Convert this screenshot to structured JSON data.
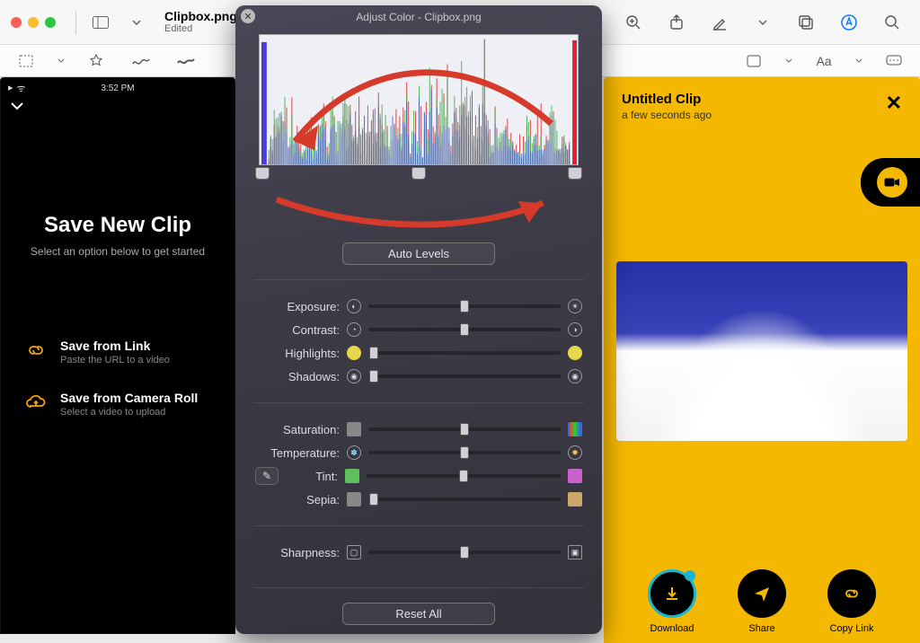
{
  "window": {
    "title": "Clipbox.png",
    "subtitle": "Edited"
  },
  "adjust_panel": {
    "title": "Adjust Color - Clipbox.png",
    "auto_levels": "Auto Levels",
    "reset_all": "Reset All",
    "levels": {
      "black": 0,
      "mid": 50,
      "white": 100
    },
    "sliders": {
      "exposure": {
        "label": "Exposure:",
        "value": 50
      },
      "contrast": {
        "label": "Contrast:",
        "value": 50
      },
      "highlights": {
        "label": "Highlights:",
        "value": 3
      },
      "shadows": {
        "label": "Shadows:",
        "value": 3
      },
      "saturation": {
        "label": "Saturation:",
        "value": 50
      },
      "temperature": {
        "label": "Temperature:",
        "value": 50
      },
      "tint": {
        "label": "Tint:",
        "value": 50
      },
      "sepia": {
        "label": "Sepia:",
        "value": 3
      },
      "sharpness": {
        "label": "Sharpness:",
        "value": 50
      }
    }
  },
  "phone_left": {
    "time": "3:52 PM",
    "heading": "Save New Clip",
    "sub": "Select an option below to get started",
    "opt1": {
      "title": "Save from Link",
      "sub": "Paste the URL to a video"
    },
    "opt2": {
      "title": "Save from Camera Roll",
      "sub": "Select a video to upload"
    }
  },
  "phone_right": {
    "title": "Untitled Clip",
    "sub": "a few seconds ago",
    "actions": {
      "download": "Download",
      "share": "Share",
      "copy": "Copy Link"
    }
  },
  "toolbar2": {
    "text_size": "Aa"
  }
}
